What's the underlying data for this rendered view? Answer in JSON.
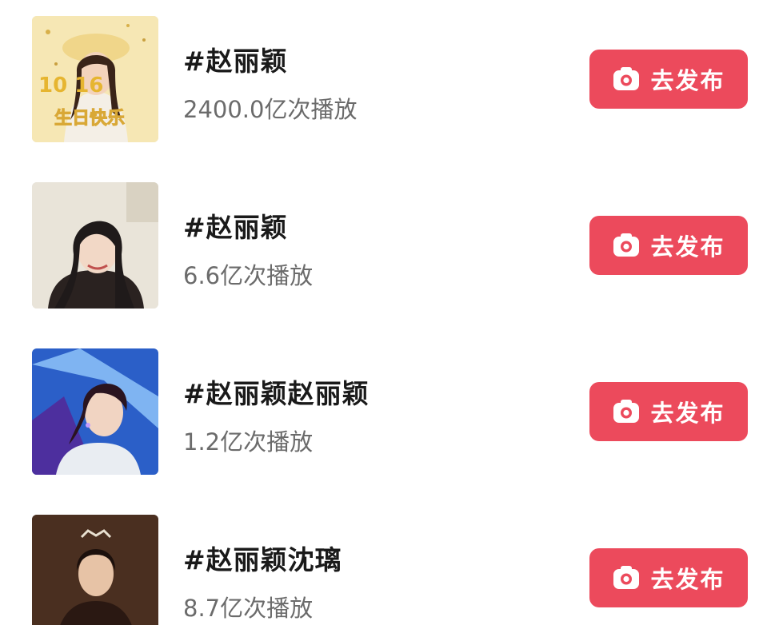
{
  "items": [
    {
      "title": "#赵丽颖",
      "plays": "2400.0亿次播放",
      "button_label": "去发布",
      "thumb_text": "生日快乐",
      "thumb_numbers": "10   16"
    },
    {
      "title": "#赵丽颖",
      "plays": "6.6亿次播放",
      "button_label": "去发布"
    },
    {
      "title": "#赵丽颖赵丽颖",
      "plays": "1.2亿次播放",
      "button_label": "去发布"
    },
    {
      "title": "#赵丽颖沈璃",
      "plays": "8.7亿次播放",
      "button_label": "去发布"
    }
  ],
  "icons": {
    "button": "camera-icon"
  },
  "colors": {
    "button_bg": "#ec4a5c",
    "title": "#1a1a1a",
    "subtitle": "#6b6b6b"
  }
}
